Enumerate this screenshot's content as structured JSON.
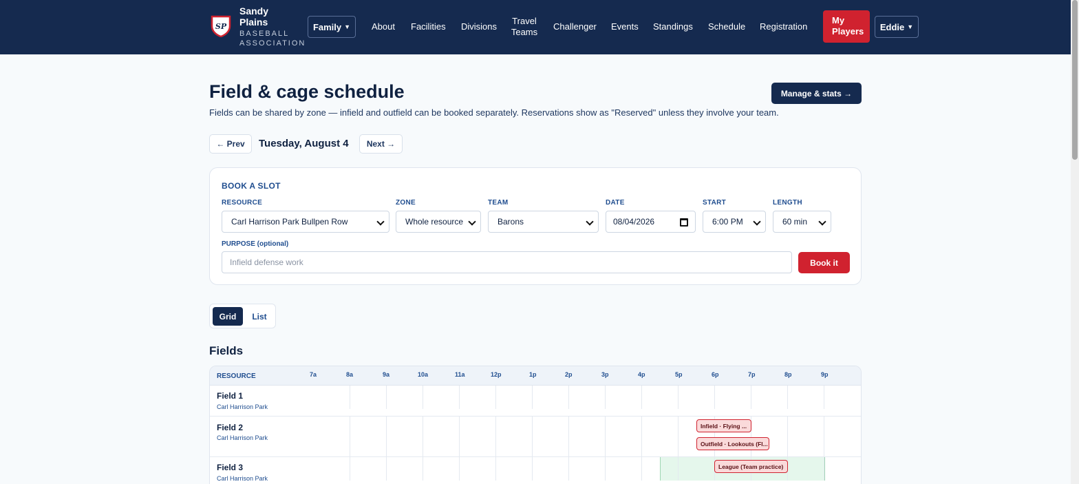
{
  "nav": {
    "brand_title": "Sandy Plains",
    "brand_sub": "BASEBALL ASSOCIATION",
    "logo_text": "SP",
    "family_label": "Family",
    "links": [
      "About",
      "Facilities",
      "Divisions",
      "Travel Teams",
      "Challenger",
      "Events",
      "Standings",
      "Schedule",
      "Registration"
    ],
    "my_players": "My Players",
    "user": "Eddie"
  },
  "header": {
    "title": "Field & cage schedule",
    "manage_label": "Manage & stats →",
    "subtitle": "Fields can be shared by zone — infield and outfield can be booked separately. Reservations show as \"Reserved\" unless they involve your team."
  },
  "date_nav": {
    "prev": "← Prev",
    "date": "Tuesday, August 4",
    "next": "Next →"
  },
  "booking": {
    "heading": "BOOK A SLOT",
    "resource_label": "RESOURCE",
    "resource_value": "Carl Harrison Park Bullpen Row",
    "zone_label": "ZONE",
    "zone_value": "Whole resource",
    "team_label": "TEAM",
    "team_value": "Barons",
    "date_label": "DATE",
    "date_value": "08/04/2026",
    "start_label": "START",
    "start_value": "6:00 PM",
    "length_label": "LENGTH",
    "length_value": "60 min",
    "purpose_label": "PURPOSE (optional)",
    "purpose_placeholder": "Infield defense work",
    "book_label": "Book it"
  },
  "view_toggle": {
    "grid": "Grid",
    "list": "List",
    "active": "Grid"
  },
  "fields_section": {
    "title": "Fields",
    "resource_header": "RESOURCE",
    "hours": [
      "7a",
      "8a",
      "9a",
      "10a",
      "11a",
      "12p",
      "1p",
      "2p",
      "3p",
      "4p",
      "5p",
      "6p",
      "7p",
      "8p",
      "9p"
    ],
    "rows": [
      {
        "name": "Field 1",
        "park": "Carl Harrison Park",
        "bookings": []
      },
      {
        "name": "Field 2",
        "park": "Carl Harrison Park",
        "bookings": [
          "Infield · Flying ...",
          "Outfield · Lookouts (Fl..."
        ]
      },
      {
        "name": "Field 3",
        "park": "Carl Harrison Park",
        "bookings": [
          "League (Team practice)"
        ]
      }
    ]
  },
  "colors": {
    "navy": "#152a4f",
    "accent_red": "#d0222f",
    "link_blue": "#1f4d8f",
    "available_green": "#e5f7ec"
  }
}
